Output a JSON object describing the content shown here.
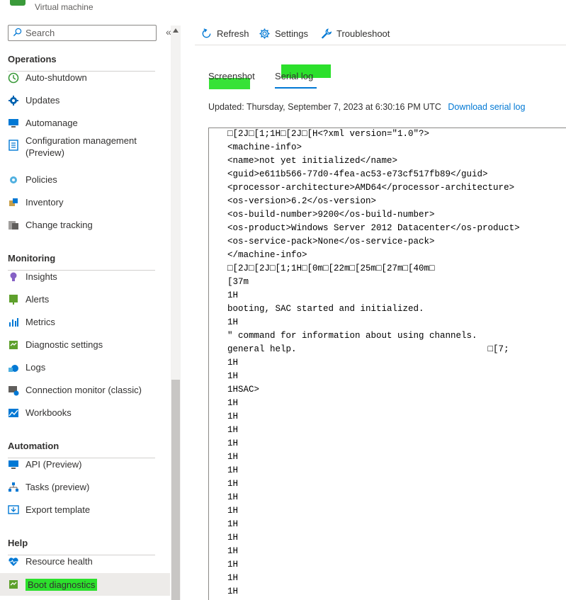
{
  "header": {
    "subtitle": "Virtual machine"
  },
  "sidebar": {
    "search_placeholder": "Search",
    "collapse_glyph": "«",
    "sections": [
      {
        "title": "Operations",
        "items": [
          {
            "label": "Auto-shutdown",
            "icon": "clock-icon"
          },
          {
            "label": "Updates",
            "icon": "gear-icon"
          },
          {
            "label": "Automanage",
            "icon": "monitor-icon"
          },
          {
            "label": "Configuration management (Preview)",
            "icon": "config-list-icon"
          },
          {
            "label": "Policies",
            "icon": "policy-icon"
          },
          {
            "label": "Inventory",
            "icon": "inventory-icon"
          },
          {
            "label": "Change tracking",
            "icon": "change-tracking-icon"
          }
        ]
      },
      {
        "title": "Monitoring",
        "items": [
          {
            "label": "Insights",
            "icon": "lightbulb-icon"
          },
          {
            "label": "Alerts",
            "icon": "alert-icon"
          },
          {
            "label": "Metrics",
            "icon": "bar-chart-icon"
          },
          {
            "label": "Diagnostic settings",
            "icon": "diagnostic-icon"
          },
          {
            "label": "Logs",
            "icon": "logs-icon"
          },
          {
            "label": "Connection monitor (classic)",
            "icon": "connection-monitor-icon"
          },
          {
            "label": "Workbooks",
            "icon": "workbook-icon"
          }
        ]
      },
      {
        "title": "Automation",
        "items": [
          {
            "label": "API (Preview)",
            "icon": "api-icon"
          },
          {
            "label": "Tasks (preview)",
            "icon": "tasks-icon"
          },
          {
            "label": "Export template",
            "icon": "export-template-icon"
          }
        ]
      },
      {
        "title": "Help",
        "items": [
          {
            "label": "Resource health",
            "icon": "heart-icon"
          },
          {
            "label": "Boot diagnostics",
            "icon": "boot-diagnostics-icon",
            "active": true
          }
        ]
      }
    ]
  },
  "toolbar": {
    "refresh_label": "Refresh",
    "settings_label": "Settings",
    "troubleshoot_label": "Troubleshoot"
  },
  "tabs": {
    "screenshot_label": "Screenshot",
    "serial_log_label": "Serial log",
    "active": "serial_log"
  },
  "status": {
    "updated_text": "Updated: Thursday, September 7, 2023 at 6:30:16 PM UTC",
    "download_link": "Download serial log"
  },
  "colors": {
    "accent": "#0078d4",
    "highlight": "#2ce02c",
    "vm_green": "#3a9a3a"
  },
  "serial_log": [
    "\u001b[2J\u001b[1;1H\u001b[2J\u001b[H<?xml version=\"1.0\"?>",
    "<machine-info>",
    "<name>not yet initialized</name>",
    "<guid>e611b566-77d0-4fea-ac53-e73cf517fb89</guid>",
    "<processor-architecture>AMD64</processor-architecture>",
    "<os-version>6.2</os-version>",
    "<os-build-number>9200</os-build-number>",
    "<os-product>Windows Server 2012 Datacenter</os-product>",
    "<os-service-pack>None</os-service-pack>",
    "</machine-info>",
    "\u001b[2J\u001b[2J\u001b[1;1H\u001b[0m\u001b[22m\u001b[25m\u001b[27m\u001b[40m\u001b",
    "[37m",
    "1H",
    "booting, SAC started and initialized.",
    "1H",
    "\" command for information about using channels.",
    "general help.                                    \u001b[7;",
    "1H",
    "1H",
    "1HSAC>",
    "1H",
    "1H",
    "1H",
    "1H",
    "1H",
    "1H",
    "1H",
    "1H",
    "1H",
    "1H",
    "1H",
    "1H",
    "1H",
    "1H",
    "1H"
  ]
}
